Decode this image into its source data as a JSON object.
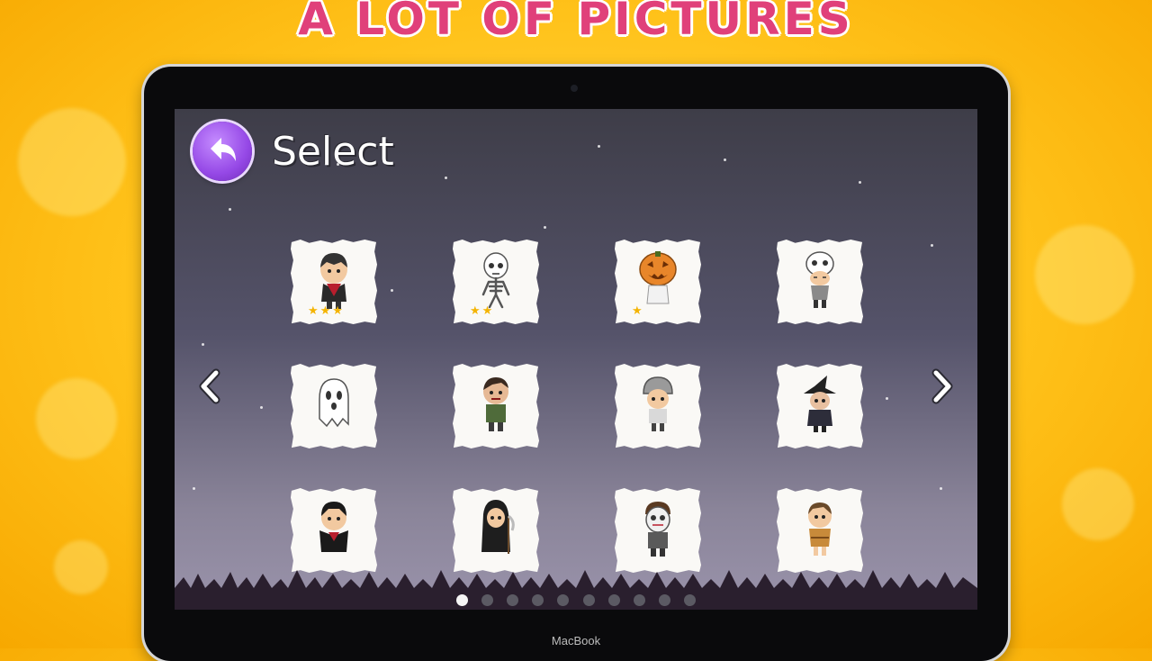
{
  "headline": "A LOT OF PICTURES",
  "laptop": {
    "brand": "MacBook"
  },
  "screen": {
    "title": "Select",
    "back_button": {
      "icon": "back-arrow-icon"
    },
    "prev_arrow_icon": "chevron-left-icon",
    "next_arrow_icon": "chevron-right-icon",
    "pagination": {
      "total_pages": 10,
      "current_page": 1
    },
    "cards": [
      {
        "character": "vampire boy",
        "stars": 3
      },
      {
        "character": "skeleton",
        "stars": 2
      },
      {
        "character": "pumpkin head",
        "stars": 1
      },
      {
        "character": "skull mask girl",
        "stars": 0
      },
      {
        "character": "ghost",
        "stars": 0
      },
      {
        "character": "zombie boy",
        "stars": 0
      },
      {
        "character": "helmet kid",
        "stars": 0
      },
      {
        "character": "witch",
        "stars": 0
      },
      {
        "character": "dark vampire",
        "stars": 0
      },
      {
        "character": "grim reaper",
        "stars": 0
      },
      {
        "character": "hockey mask",
        "stars": 0
      },
      {
        "character": "caveman",
        "stars": 0
      }
    ]
  },
  "colors": {
    "headline": "#e0407a",
    "back_button": "#9548e6",
    "star": "#f4b400"
  }
}
